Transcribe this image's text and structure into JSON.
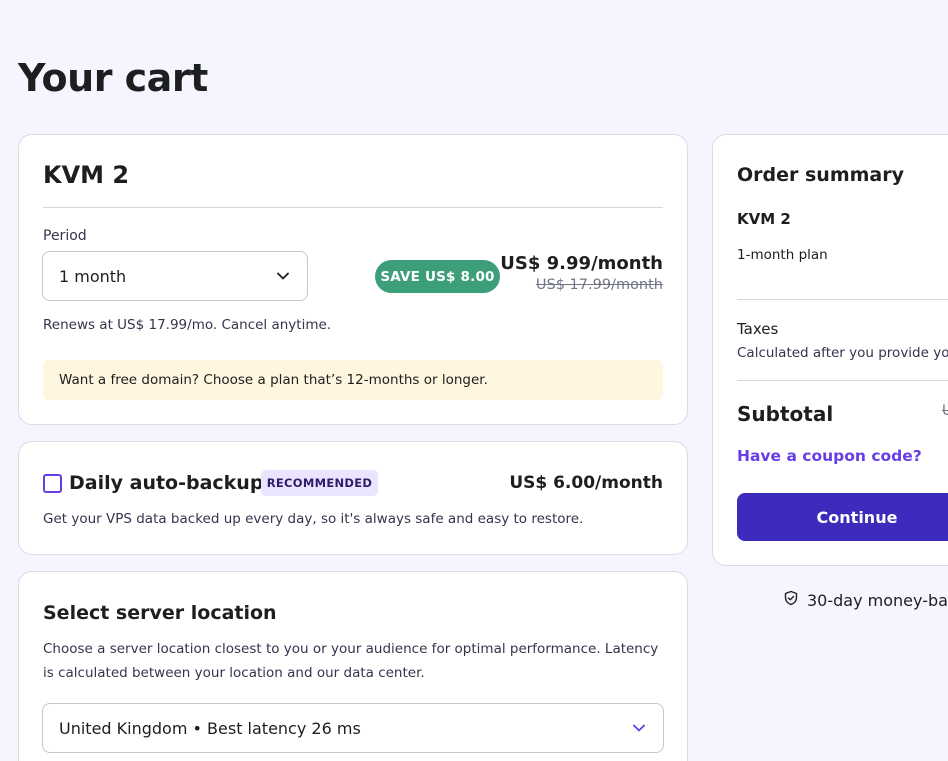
{
  "page": {
    "title": "Your cart"
  },
  "plan": {
    "name": "KVM 2",
    "period_label": "Period",
    "period_value": "1 month",
    "save_badge": "SAVE US$ 8.00",
    "price": "US$ 9.99/month",
    "old_price": "US$ 17.99/month",
    "renews_note": "Renews at US$ 17.99/mo. Cancel anytime.",
    "domain_note": "Want a free domain? Choose a plan that’s 12-months or longer."
  },
  "backup": {
    "title": "Daily auto-backup",
    "badge": "RECOMMENDED",
    "price": "US$ 6.00/month",
    "description": "Get your VPS data backed up every day, so it's always safe and easy to restore.",
    "checked": false
  },
  "location": {
    "title": "Select server location",
    "description": "Choose a server location closest to you or your audience for optimal performance. Latency is calculated between your location and our data center.",
    "selected": "United Kingdom • Best latency 26 ms"
  },
  "summary": {
    "title": "Order summary",
    "plan_name": "KVM 2",
    "plan_period": "1-month plan",
    "taxes_label": "Taxes",
    "taxes_note": "Calculated after you provide you",
    "subtotal_label": "Subtotal",
    "subtotal_value": "U",
    "coupon_link": "Have a coupon code?",
    "continue_label": "Continue"
  },
  "guarantee": {
    "text": "30-day money-bac"
  },
  "icons": {
    "period_chevron": "chevron-down-icon",
    "location_chevron": "chevron-down-icon",
    "guarantee": "shield-check-icon"
  },
  "colors": {
    "accent": "#673de6",
    "primary_button": "#3c2bbd",
    "save_badge": "#3d9e7a",
    "domain_note_bg": "#fef6df",
    "background": "#f4f5ff"
  }
}
